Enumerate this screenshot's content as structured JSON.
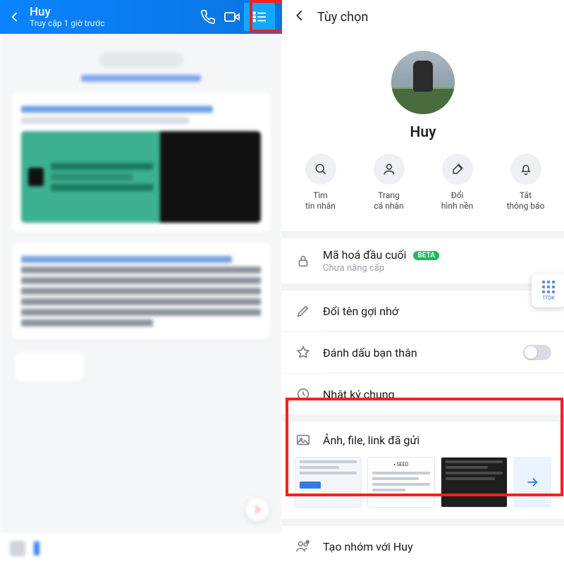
{
  "left": {
    "contact_name": "Huy",
    "status": "Truy cập 1 giờ trước"
  },
  "right": {
    "header_title": "Tùy chọn",
    "profile_name": "Huy",
    "quick_actions": {
      "search": "Tìm\ntin nhắn",
      "profile": "Trang\ncá nhân",
      "wallpaper": "Đổi\nhình nền",
      "mute": "Tắt\nthông báo"
    },
    "encryption": {
      "title": "Mã hoá đầu cuối",
      "badge": "BETA",
      "sub": "Chưa nâng cấp"
    },
    "rename": "Đổi tên gợi nhớ",
    "best_friend": "Đánh dấu bạn thân",
    "mutual_journal": "Nhật ký chung",
    "media_title": "Ảnh, file, link đã gửi",
    "create_group": "Tạo nhóm với Huy",
    "badge_text": "TTDK"
  }
}
